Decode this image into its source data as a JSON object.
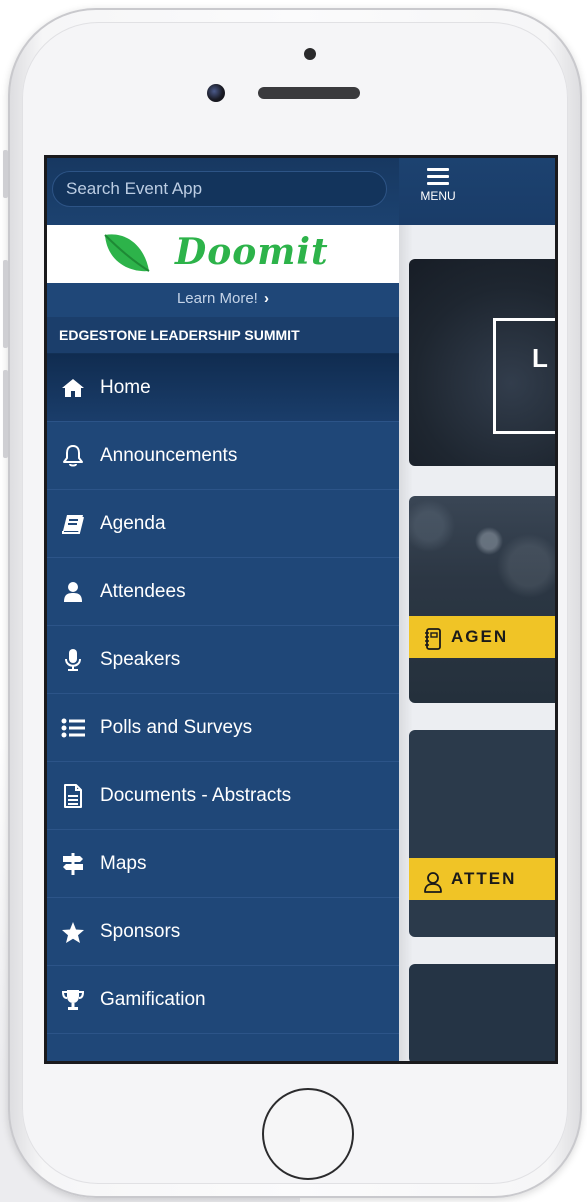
{
  "search": {
    "placeholder": "Search Event App"
  },
  "sponsor": {
    "logo_text": "Doomit",
    "learn_more": "Learn More!",
    "learn_more_chevron": "›"
  },
  "event": {
    "title": "EDGESTONE LEADERSHIP SUMMIT"
  },
  "menu": {
    "button_label": "MENU",
    "items": [
      {
        "label": "Home",
        "icon": "home-icon"
      },
      {
        "label": "Announcements",
        "icon": "bell-icon"
      },
      {
        "label": "Agenda",
        "icon": "book-icon"
      },
      {
        "label": "Attendees",
        "icon": "user-icon"
      },
      {
        "label": "Speakers",
        "icon": "microphone-icon"
      },
      {
        "label": "Polls and Surveys",
        "icon": "list-icon"
      },
      {
        "label": "Documents - Abstracts",
        "icon": "document-icon"
      },
      {
        "label": "Maps",
        "icon": "signpost-icon"
      },
      {
        "label": "Sponsors",
        "icon": "star-icon"
      },
      {
        "label": "Gamification",
        "icon": "trophy-icon"
      }
    ]
  },
  "cards": {
    "hero_letter": "L",
    "agenda_label": "AGEN",
    "attendees_label": "ATTEN"
  },
  "colors": {
    "sidebar": "#1f4778",
    "accent_yellow": "#f0c426",
    "brand_green": "#2db34a"
  }
}
